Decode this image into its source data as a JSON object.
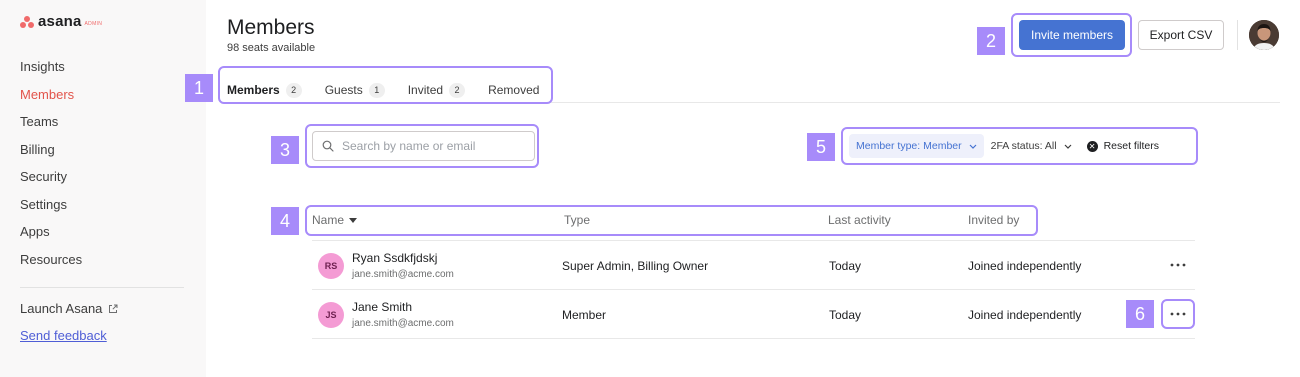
{
  "brand": {
    "word": "asana",
    "badge": "ADMIN",
    "color": "#f06a6a"
  },
  "sidebar": {
    "items": [
      {
        "label": "Insights",
        "active": false
      },
      {
        "label": "Members",
        "active": true
      },
      {
        "label": "Teams",
        "active": false
      },
      {
        "label": "Billing",
        "active": false
      },
      {
        "label": "Security",
        "active": false
      },
      {
        "label": "Settings",
        "active": false
      },
      {
        "label": "Apps",
        "active": false
      },
      {
        "label": "Resources",
        "active": false
      }
    ],
    "launch_label": "Launch Asana",
    "feedback_label": "Send feedback"
  },
  "header": {
    "title": "Members",
    "subtitle": "98 seats available",
    "invite_label": "Invite members",
    "export_label": "Export CSV"
  },
  "tabs": [
    {
      "label": "Members",
      "count": "2"
    },
    {
      "label": "Guests",
      "count": "1"
    },
    {
      "label": "Invited",
      "count": "2"
    },
    {
      "label": "Removed",
      "count": ""
    }
  ],
  "search": {
    "placeholder": "Search by name or email",
    "value": ""
  },
  "filters": {
    "member_type": "Member type: Member",
    "twofa": "2FA status: All",
    "reset_label": "Reset filters"
  },
  "table": {
    "columns": [
      "Name",
      "Type",
      "Last activity",
      "Invited by"
    ],
    "rows": [
      {
        "initials": "RS",
        "name": "Ryan Ssdkfjdskj",
        "email": "jane.smith@acme.com",
        "type": "Super Admin, Billing Owner",
        "last_activity": "Today",
        "invited_by": "Joined independently"
      },
      {
        "initials": "JS",
        "name": "Jane Smith",
        "email": "jane.smith@acme.com",
        "type": "Member",
        "last_activity": "Today",
        "invited_by": "Joined independently"
      }
    ]
  },
  "annotations": [
    "1",
    "2",
    "3",
    "4",
    "5",
    "6"
  ],
  "colors": {
    "accent": "#4573d2",
    "active_nav": "#e2544b",
    "annotation": "#a78bfa",
    "avatar": "#f49bd4"
  }
}
